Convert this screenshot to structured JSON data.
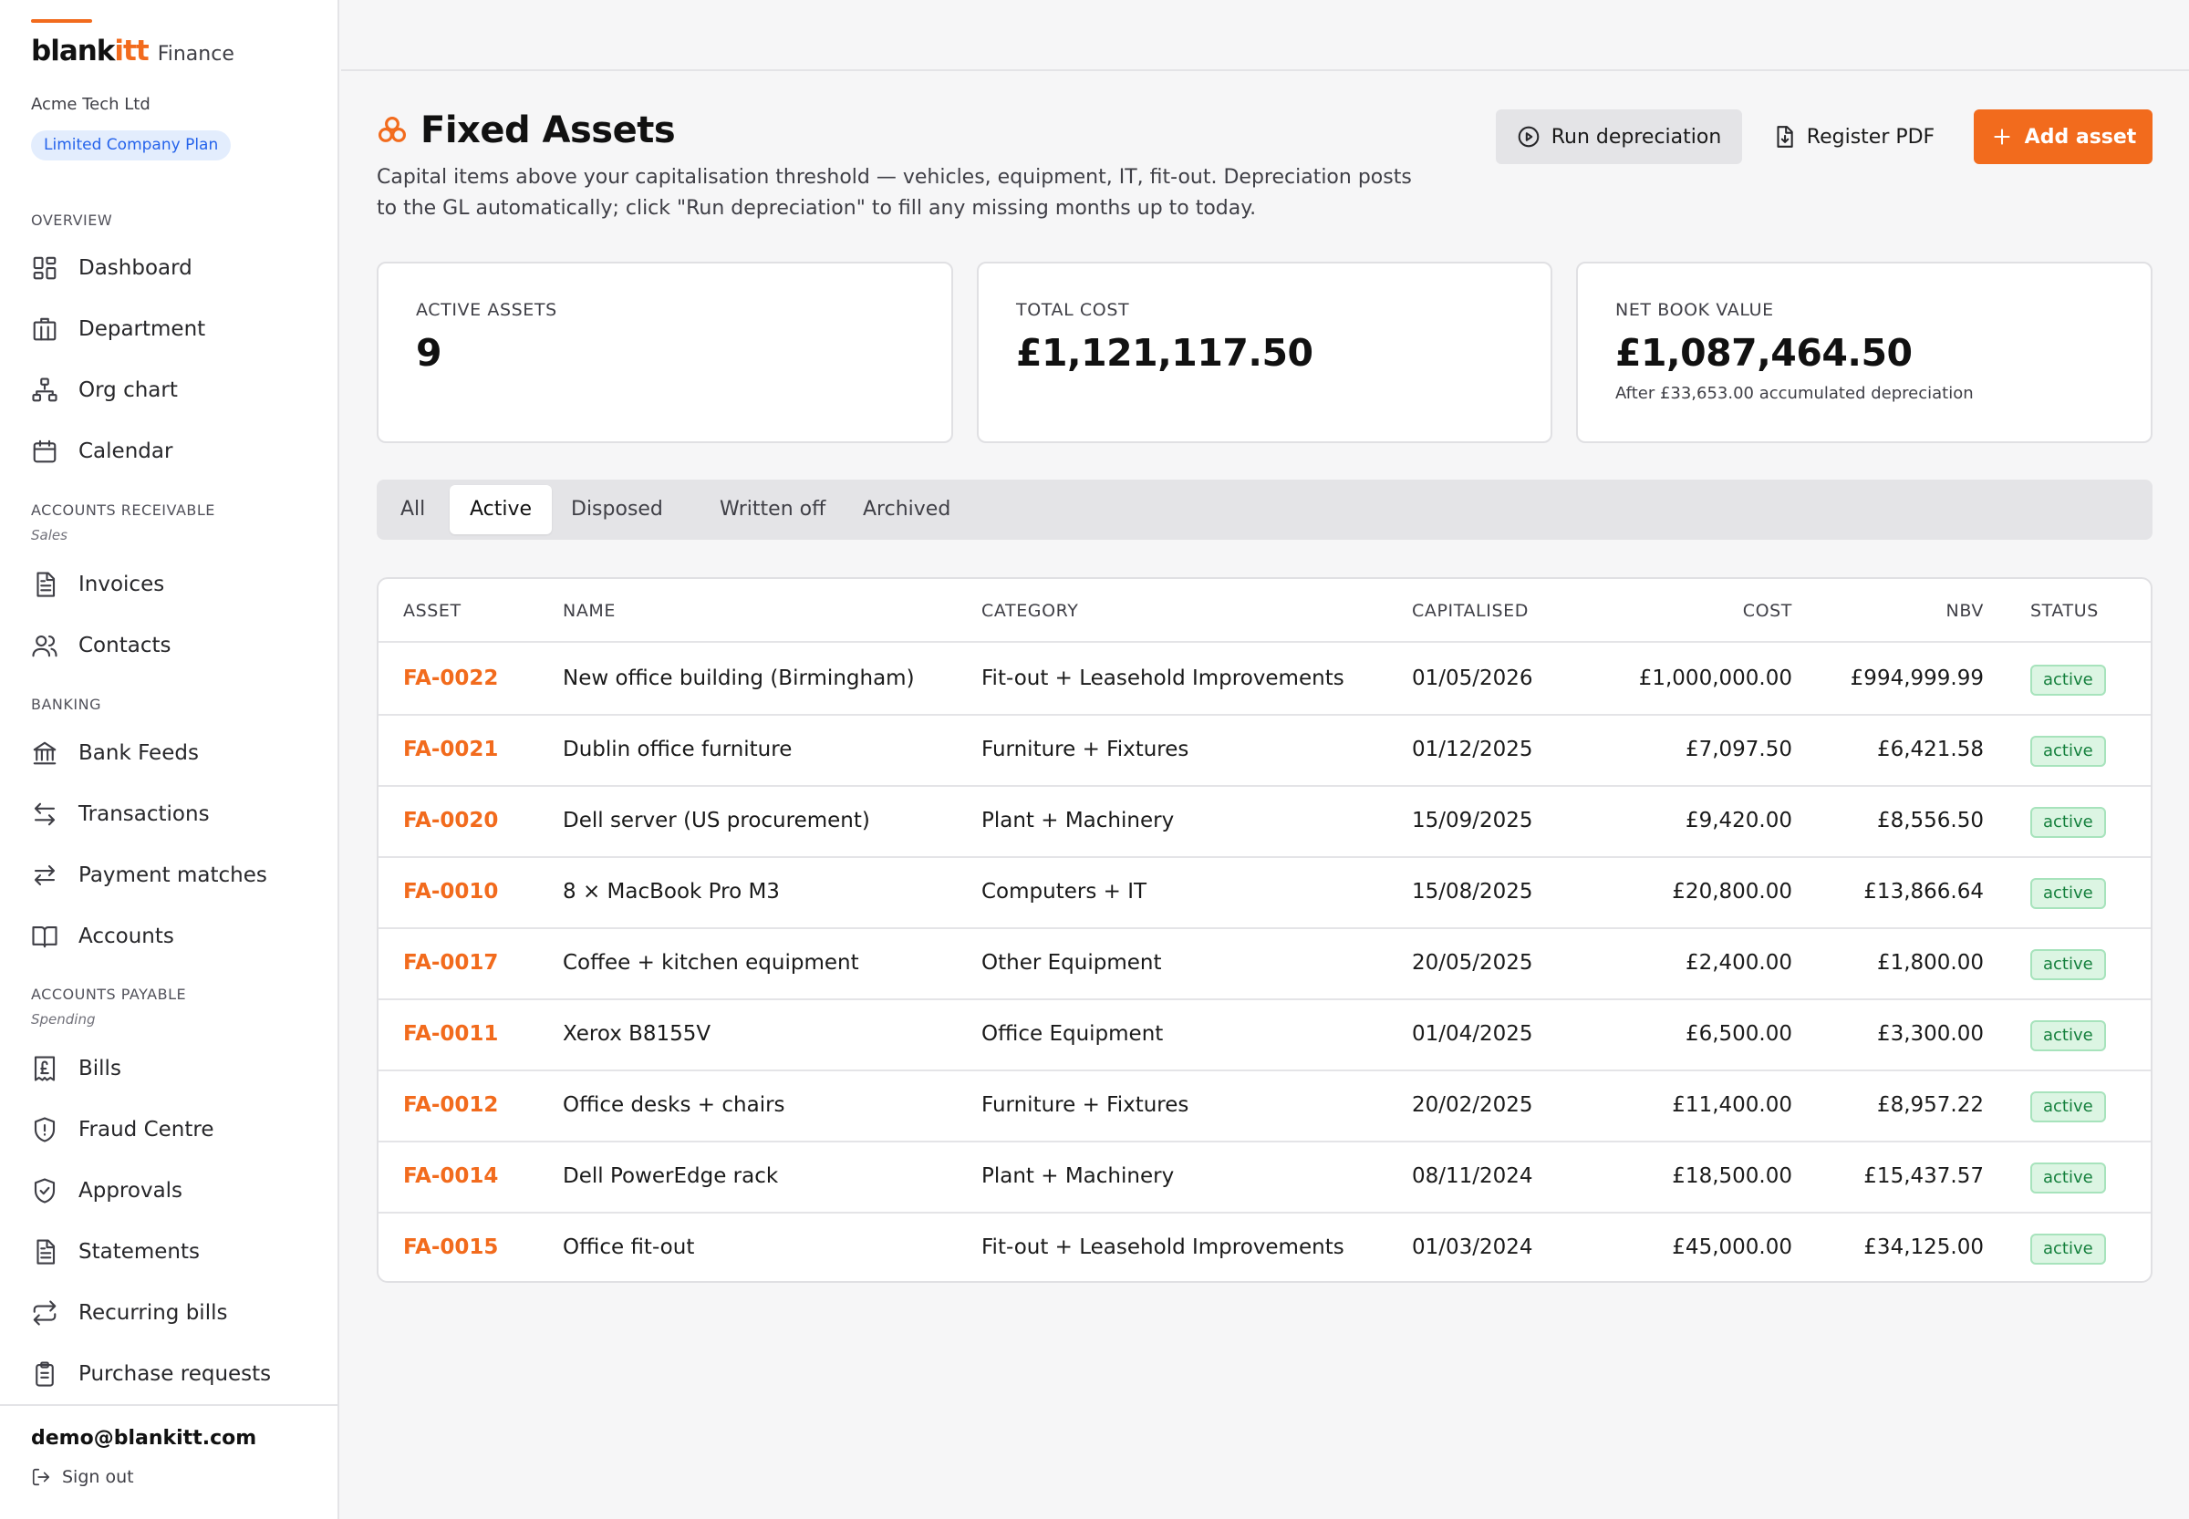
{
  "brand": {
    "name_main": "blank",
    "name_accent": "itt",
    "suffix": "Finance"
  },
  "company": "Acme Tech Ltd",
  "plan": "Limited Company Plan",
  "nav": {
    "overview": "OVERVIEW",
    "overview_items": [
      {
        "label": "Dashboard",
        "icon": "dashboard-icon"
      },
      {
        "label": "Department",
        "icon": "building-icon"
      },
      {
        "label": "Org chart",
        "icon": "org-chart-icon"
      },
      {
        "label": "Calendar",
        "icon": "calendar-icon"
      }
    ],
    "ar": "ACCOUNTS RECEIVABLE",
    "ar_sub": "Sales",
    "ar_items": [
      {
        "label": "Invoices",
        "icon": "document-icon"
      },
      {
        "label": "Contacts",
        "icon": "users-icon"
      }
    ],
    "banking": "BANKING",
    "banking_items": [
      {
        "label": "Bank Feeds",
        "icon": "bank-icon"
      },
      {
        "label": "Transactions",
        "icon": "transactions-icon"
      },
      {
        "label": "Payment matches",
        "icon": "swap-icon"
      },
      {
        "label": "Accounts",
        "icon": "book-icon"
      }
    ],
    "ap": "ACCOUNTS PAYABLE",
    "ap_sub": "Spending",
    "ap_items": [
      {
        "label": "Bills",
        "icon": "pound-receipt-icon"
      },
      {
        "label": "Fraud Centre",
        "icon": "shield-alert-icon"
      },
      {
        "label": "Approvals",
        "icon": "shield-check-icon"
      },
      {
        "label": "Statements",
        "icon": "document-icon"
      },
      {
        "label": "Recurring bills",
        "icon": "repeat-icon"
      },
      {
        "label": "Purchase requests",
        "icon": "clipboard-icon"
      }
    ]
  },
  "user": {
    "email": "demo@blankitt.com",
    "signout": "Sign out"
  },
  "page": {
    "title": "Fixed Assets",
    "description": "Capital items above your capitalisation threshold — vehicles, equipment, IT, fit-out. Depreciation posts to the GL automatically; click \"Run depreciation\" to fill any missing months up to today."
  },
  "actions": {
    "run": "Run depreciation",
    "pdf": "Register PDF",
    "add": "Add asset"
  },
  "stats": [
    {
      "label": "ACTIVE ASSETS",
      "value": "9",
      "note": ""
    },
    {
      "label": "TOTAL COST",
      "value": "£1,121,117.50",
      "note": ""
    },
    {
      "label": "NET BOOK VALUE",
      "value": "£1,087,464.50",
      "note": "After £33,653.00 accumulated depreciation"
    }
  ],
  "tabs": [
    "All",
    "Active",
    "Disposed",
    "Written off",
    "Archived"
  ],
  "active_tab": "Active",
  "table": {
    "headers": [
      "ASSET",
      "NAME",
      "CATEGORY",
      "CAPITALISED",
      "COST",
      "NBV",
      "STATUS"
    ],
    "rows": [
      {
        "id": "FA-0022",
        "name": "New office building (Birmingham)",
        "category": "Fit-out + Leasehold Improvements",
        "capitalised": "01/05/2026",
        "cost": "£1,000,000.00",
        "nbv": "£994,999.99",
        "status": "active"
      },
      {
        "id": "FA-0021",
        "name": "Dublin office furniture",
        "category": "Furniture + Fixtures",
        "capitalised": "01/12/2025",
        "cost": "£7,097.50",
        "nbv": "£6,421.58",
        "status": "active"
      },
      {
        "id": "FA-0020",
        "name": "Dell server (US procurement)",
        "category": "Plant + Machinery",
        "capitalised": "15/09/2025",
        "cost": "£9,420.00",
        "nbv": "£8,556.50",
        "status": "active"
      },
      {
        "id": "FA-0010",
        "name": "8 × MacBook Pro M3",
        "category": "Computers + IT",
        "capitalised": "15/08/2025",
        "cost": "£20,800.00",
        "nbv": "£13,866.64",
        "status": "active"
      },
      {
        "id": "FA-0017",
        "name": "Coffee + kitchen equipment",
        "category": "Other Equipment",
        "capitalised": "20/05/2025",
        "cost": "£2,400.00",
        "nbv": "£1,800.00",
        "status": "active"
      },
      {
        "id": "FA-0011",
        "name": "Xerox B8155V",
        "category": "Office Equipment",
        "capitalised": "01/04/2025",
        "cost": "£6,500.00",
        "nbv": "£3,300.00",
        "status": "active"
      },
      {
        "id": "FA-0012",
        "name": "Office desks + chairs",
        "category": "Furniture + Fixtures",
        "capitalised": "20/02/2025",
        "cost": "£11,400.00",
        "nbv": "£8,957.22",
        "status": "active"
      },
      {
        "id": "FA-0014",
        "name": "Dell PowerEdge rack",
        "category": "Plant + Machinery",
        "capitalised": "08/11/2024",
        "cost": "£18,500.00",
        "nbv": "£15,437.57",
        "status": "active"
      },
      {
        "id": "FA-0015",
        "name": "Office fit-out",
        "category": "Fit-out + Leasehold Improvements",
        "capitalised": "01/03/2024",
        "cost": "£45,000.00",
        "nbv": "£34,125.00",
        "status": "active"
      }
    ]
  },
  "colors": {
    "accent": "#f26b1d",
    "plan_badge": "#2563eb",
    "status_active": "#15803d"
  }
}
